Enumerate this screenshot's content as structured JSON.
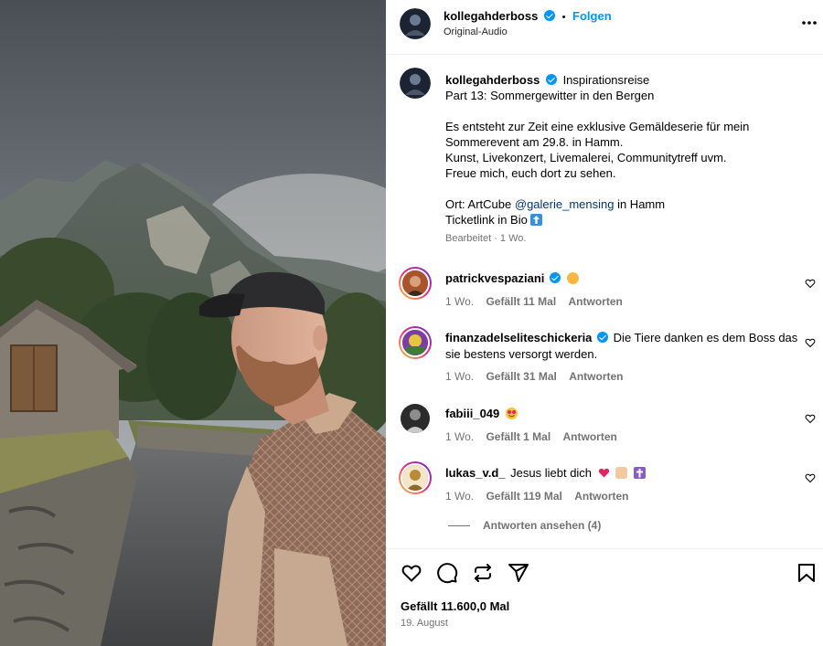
{
  "post": {
    "author": "kollegahderboss",
    "separator": "•",
    "follow_label": "Folgen",
    "audio": "Original-Audio",
    "more_label": "•••"
  },
  "caption": {
    "author": "kollegahderboss",
    "title": "Inspirationsreise",
    "line1": "Part 13: Sommergewitter in den Bergen",
    "line2": "Es entsteht zur Zeit eine exklusive Gemäldeserie für mein",
    "line3": "Sommerevent am 29.8. in Hamm.",
    "line4": "Kunst, Livekonzert, Livemalerei, Communitytreff uvm.",
    "line5": "Freue mich, euch dort zu sehen.",
    "line6_prefix": "Ort: ArtCube ",
    "line6_mention": "@galerie_mensing",
    "line6_suffix": " in Hamm",
    "line7": "Ticketlink in Bio",
    "edited": "Bearbeitet · 1 Wo."
  },
  "comments": [
    {
      "user": "patrickvespaziani",
      "verified": true,
      "text": "",
      "emoji": [
        "raising-hands"
      ],
      "time": "1 Wo.",
      "likes": "Gefällt 11 Mal",
      "reply": "Antworten"
    },
    {
      "user": "finanzadelselitesc hickeria",
      "verified": true,
      "text": "Die Tiere danken es dem Boss das sie bestens versorgt werden.",
      "emoji": [],
      "time": "1 Wo.",
      "likes": "Gefällt 31 Mal",
      "reply": "Antworten"
    },
    {
      "user": "fabiii_049",
      "verified": false,
      "text": "",
      "emoji": [
        "heart-eyes"
      ],
      "time": "1 Wo.",
      "likes": "Gefällt 1 Mal",
      "reply": "Antworten"
    },
    {
      "user": "lukas_v.d_",
      "verified": false,
      "text": "Jesus liebt dich",
      "emoji": [
        "heart",
        "praying-hands",
        "latin-cross"
      ],
      "time": "1 Wo.",
      "likes": "Gefällt 119 Mal",
      "reply": "Antworten"
    }
  ],
  "comment_names": {
    "c1": "patrickvespaziani",
    "c2": "finanzadelseliteschickeria",
    "c3": "fabiii_049",
    "c4": "lukas_v.d_"
  },
  "view_replies": "Antworten ansehen (4)",
  "footer": {
    "likes": "Gefällt 11.600,0 Mal",
    "date": "19. August"
  },
  "colors": {
    "accent": "#0095f6",
    "muted": "#737373",
    "mention": "#00376b"
  },
  "icons": [
    "heart-icon",
    "comment-icon",
    "repost-icon",
    "share-icon",
    "bookmark-icon",
    "more-icon",
    "verified-icon"
  ]
}
